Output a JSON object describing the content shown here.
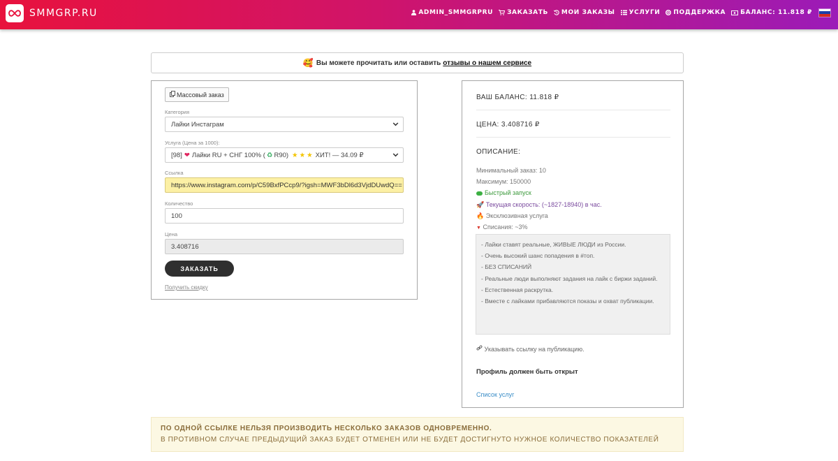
{
  "nav": {
    "brand": "SMMGRP.RU",
    "user": "ADMIN_SMMGRPRU",
    "order": "ЗАКАЗАТЬ",
    "my_orders": "МОИ ЗАКАЗЫ",
    "services": "УСЛУГИ",
    "support": "ПОДДЕРЖКА",
    "balance": "БАЛАНС: 11.818 ₽"
  },
  "reviews_alert": {
    "text": "Вы можете прочитать или оставить",
    "link": "отзывы о нашем сервисе"
  },
  "form": {
    "mass_order": "Массовый заказ",
    "category_label": "Категория",
    "category_value": "Лайки Инстаграм",
    "service_label": "Услуга (Цена за 1000):",
    "service_prefix": "[98]",
    "service_name": "Лайки RU + СНГ 100% (",
    "service_r": "R90)",
    "service_suffix": "ХИТ! — 34.09 ₽",
    "link_label": "Ссылка",
    "link_value": "https://www.instagram.com/p/C59BxfPCcp9/?igsh=MWF3bDl6d3VjdDUwdQ==",
    "quantity_label": "Количество",
    "quantity_value": "100",
    "price_label": "Цена",
    "price_value": "3.408716",
    "submit": "ЗАКАЗАТЬ",
    "discount": "Получить скидку"
  },
  "info": {
    "balance": "ВАШ БАЛАНС: 11.818 ₽",
    "price": "ЦЕНА: 3.408716 ₽",
    "description_title": "ОПИСАНИЕ:",
    "min_order": "Минимальный заказ: 10",
    "max_order": "Максимум: 150000",
    "fast_start": "Быстрый запуск",
    "speed": "Текущая скорость: (~1827-18940) в час.",
    "exclusive": "Эксклюзивная услуга",
    "writeoffs": "Списания: ~3%",
    "desc_lines": [
      "- Лайки ставят реальные, ЖИВЫЕ ЛЮДИ из России.",
      "- Очень высокий шанс попадения в #топ.",
      "- БЕЗ СПИСАНИЙ",
      "- Реальные люди выполняют задания на лайк с биржи заданий.",
      "- Естественная раскрутка.",
      "- Вместе с лайками прибавляются показы и охват публикации."
    ],
    "link_hint": "Указывать ссылку на публикацию.",
    "profile_note": "Профиль должен быть открыт",
    "services_list": "Список услуг"
  },
  "warning": {
    "line1": "ПО ОДНОЙ ССЫЛКЕ НЕЛЬЗЯ ПРОИЗВОДИТЬ НЕСКОЛЬКО ЗАКАЗОВ ОДНОВРЕМЕННО.",
    "line2": "В ПРОТИВНОМ СЛУЧАЕ ПРЕДЫДУЩИЙ ЗАКАЗ БУДЕТ ОТМЕНЕН ИЛИ НЕ БУДЕТ ДОСТИГНУТО НУЖНОЕ КОЛИЧЕСТВО ПОКАЗАТЕЛЕЙ"
  },
  "colors": {
    "nav_gradient_start": "#e8123d",
    "nav_gradient_end": "#9b1bb8",
    "link_field_bg": "#fcf0a5",
    "warning_bg": "#fcf8e3",
    "warning_text": "#8a6d3b"
  }
}
